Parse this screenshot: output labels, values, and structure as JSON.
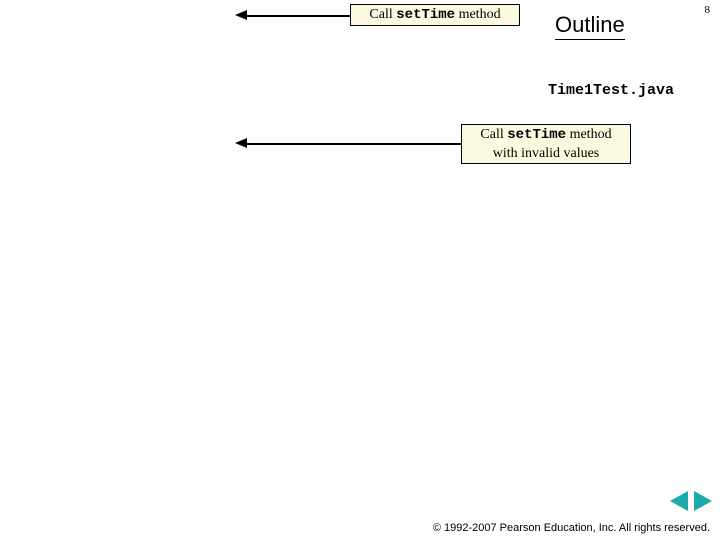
{
  "page_number": "8",
  "outline_label": "Outline",
  "filename": "Time1Test.java",
  "callout1": {
    "prefix": "Call ",
    "code": "setTime",
    "suffix": " method"
  },
  "callout2": {
    "prefix": "Call ",
    "code": "setTime",
    "suffix": " method",
    "line2": "with invalid values"
  },
  "footer": "© 1992-2007 Pearson Education, Inc. All rights reserved."
}
